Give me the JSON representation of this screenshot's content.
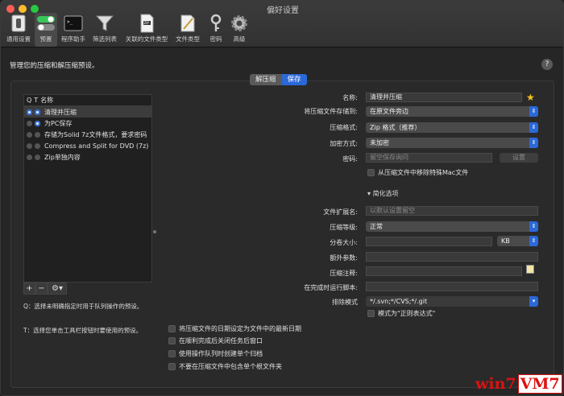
{
  "window": {
    "title": "偏好设置"
  },
  "toolbar": [
    {
      "label": "通用设置",
      "icon": "switch-icon"
    },
    {
      "label": "预置",
      "icon": "toggles-icon"
    },
    {
      "label": "程序助手",
      "icon": "terminal-icon"
    },
    {
      "label": "筛选列表",
      "icon": "funnel-icon"
    },
    {
      "label": "关联的文件类型",
      "icon": "zip-document-icon"
    },
    {
      "label": "文件类型",
      "icon": "document-pen-icon"
    },
    {
      "label": "密码",
      "icon": "key-icon"
    },
    {
      "label": "高级",
      "icon": "gear-icon"
    }
  ],
  "heading": "管理您的压缩和解压缩预设。",
  "help": "?",
  "tabs": {
    "extract": "解压缩",
    "save": "保存"
  },
  "list": {
    "headers": {
      "q": "Q",
      "t": "T",
      "name": "名称"
    },
    "items": [
      {
        "name": "清理并压缩",
        "q": true,
        "t": true
      },
      {
        "name": "为PC保存",
        "q": false,
        "t": true
      },
      {
        "name": "存储为Solid 7z文件格式，要求密码",
        "q": false,
        "t": false
      },
      {
        "name": "Compress and Split for DVD (7z)",
        "q": false,
        "t": false
      },
      {
        "name": "Zip单独内容",
        "q": false,
        "t": false
      }
    ]
  },
  "list_buttons": {
    "add": "+",
    "remove": "−",
    "gear": "⚙▾"
  },
  "notes": {
    "q": "Q：选择未明确指定时用于队列操作的预设。",
    "t": "T：选择您单击工具栏按钮时要使用的预设。"
  },
  "form": {
    "name_label": "名称:",
    "name_value": "清理并压缩",
    "save_to_label": "将压缩文件存储到:",
    "save_to_value": "在原文件旁边",
    "format_label": "压缩格式:",
    "format_value": "Zip 格式（推荐）",
    "encrypt_label": "加密方式:",
    "encrypt_value": "未加密",
    "password_label": "密码:",
    "password_placeholder": "留空保存询问",
    "set_button": "设置",
    "remove_mac_label": "从压缩文件中移除特殊Mac文件",
    "simplify_label": "简化选项",
    "ext_label": "文件扩展名:",
    "ext_placeholder": "以默认设置留空",
    "level_label": "压缩等级:",
    "level_value": "正常",
    "split_label": "分卷大小:",
    "split_unit": "KB",
    "extra_label": "额外参数:",
    "comment_label": "压缩注释:",
    "script_label": "在完成时运行脚本:",
    "exclude_label": "排除模式",
    "exclude_value": "*/.svn;*/CVS;*/.git",
    "regex_label": "模式为\"正则表达式\""
  },
  "bottom_checks": [
    "将压缩文件的日期设定为文件中的最新日期",
    "在顺利完成后关闭任务后窗口",
    "使用操作队列时创建单个归档",
    "不要在压缩文件中包含单个根文件夹"
  ],
  "watermark": {
    "a": "win7",
    "b": "VM7"
  },
  "colors": {
    "accent": "#2b68d8",
    "star": "#f5c21b"
  }
}
